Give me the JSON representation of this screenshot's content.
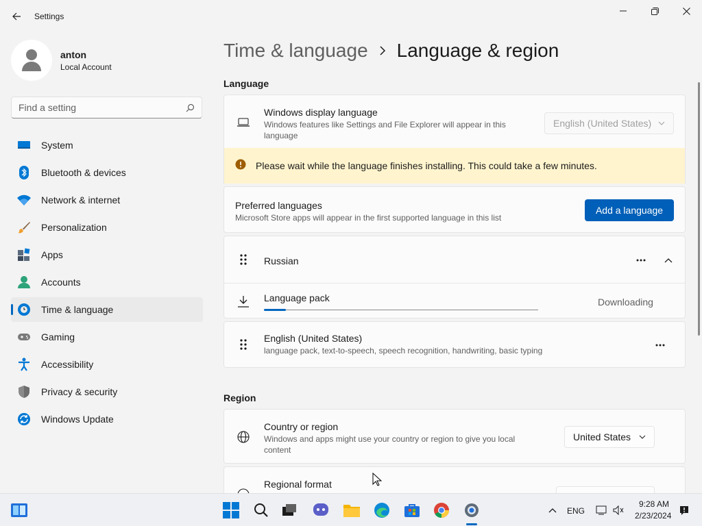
{
  "window": {
    "title": "Settings"
  },
  "profile": {
    "name": "anton",
    "account_type": "Local Account"
  },
  "search": {
    "placeholder": "Find a setting"
  },
  "sidebar": {
    "items": [
      {
        "label": "System",
        "icon": "system-icon"
      },
      {
        "label": "Bluetooth & devices",
        "icon": "bluetooth-icon"
      },
      {
        "label": "Network & internet",
        "icon": "wifi-icon"
      },
      {
        "label": "Personalization",
        "icon": "brush-icon"
      },
      {
        "label": "Apps",
        "icon": "apps-icon"
      },
      {
        "label": "Accounts",
        "icon": "person-icon"
      },
      {
        "label": "Time & language",
        "icon": "globe-clock-icon",
        "active": true
      },
      {
        "label": "Gaming",
        "icon": "gamepad-icon"
      },
      {
        "label": "Accessibility",
        "icon": "accessibility-icon"
      },
      {
        "label": "Privacy & security",
        "icon": "shield-icon"
      },
      {
        "label": "Windows Update",
        "icon": "update-icon"
      }
    ]
  },
  "breadcrumb": {
    "parent": "Time & language",
    "current": "Language & region"
  },
  "language_section": {
    "title": "Language",
    "display_language": {
      "title": "Windows display language",
      "description": "Windows features like Settings and File Explorer will appear in this language",
      "value": "English (United States)"
    },
    "warning": "Please wait while the language finishes installing. This could take a few minutes.",
    "preferred": {
      "title": "Preferred languages",
      "description": "Microsoft Store apps will appear in the first supported language in this list",
      "button": "Add a language"
    },
    "languages": [
      {
        "name": "Russian",
        "pack_label": "Language pack",
        "status": "Downloading",
        "progress": 0.08
      },
      {
        "name": "English (United States)",
        "features": "language pack, text-to-speech, speech recognition, handwriting, basic typing"
      }
    ]
  },
  "region_section": {
    "title": "Region",
    "country": {
      "title": "Country or region",
      "description": "Windows and apps might use your country or region to give you local content",
      "value": "United States"
    },
    "format": {
      "title": "Regional format"
    }
  },
  "taskbar": {
    "apps": [
      "start-icon",
      "search-icon",
      "task-view-icon",
      "chat-icon",
      "file-explorer-icon",
      "edge-icon",
      "store-icon",
      "chrome-icon",
      "settings-icon"
    ],
    "language": "ENG",
    "time": "9:28 AM",
    "date": "2/23/2024"
  },
  "colors": {
    "accent": "#0067c0",
    "button": "#005fb8",
    "warning_bg": "#fff4ce",
    "warning_icon": "#9d5d00"
  }
}
